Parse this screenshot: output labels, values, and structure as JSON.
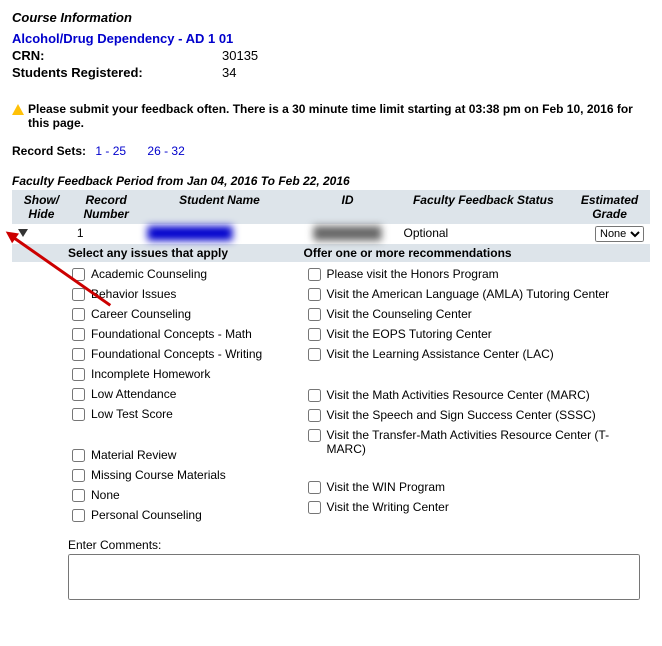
{
  "course": {
    "header": "Course Information",
    "title": "Alcohol/Drug Dependency - AD 1 01",
    "crn_label": "CRN:",
    "crn_value": "30135",
    "students_label": "Students Registered:",
    "students_value": "34"
  },
  "alert": "Please submit your feedback often. There is a 30 minute time limit starting at 03:38 pm on Feb 10, 2016 for this page.",
  "record_sets": {
    "label": "Record Sets:",
    "range1": "1 - 25",
    "range2": "26 - 32"
  },
  "period": "Faculty Feedback Period from Jan 04, 2016 To Feb 22, 2016",
  "columns": {
    "showhide": "Show/ Hide",
    "record": "Record Number",
    "name": "Student Name",
    "id": "ID",
    "status": "Faculty Feedback Status",
    "grade": "Estimated Grade"
  },
  "row": {
    "record_number": "1",
    "name_redacted": "██████████",
    "id_redacted": "████████",
    "status": "Optional",
    "grade_selected": "None"
  },
  "sections": {
    "issues_header": "Select any issues that apply",
    "recs_header": "Offer one or more recommendations"
  },
  "issues": [
    "Academic Counseling",
    "Behavior Issues",
    "Career Counseling",
    "Foundational Concepts - Math",
    "Foundational Concepts - Writing",
    "Incomplete Homework",
    "Low Attendance",
    "Low Test Score",
    "Material Review",
    "Missing Course Materials",
    "None",
    "Personal Counseling"
  ],
  "recommendations": [
    "Please visit the Honors Program",
    "Visit the American Language (AMLA) Tutoring Center",
    "Visit the Counseling Center",
    "Visit the EOPS Tutoring Center",
    "Visit the Learning Assistance Center (LAC)",
    "Visit the Math Activities Resource Center (MARC)",
    "Visit the Speech and Sign Success Center (SSSC)",
    "Visit the Transfer-Math Activities Resource Center (T-MARC)",
    "Visit the WIN Program",
    "Visit the Writing Center"
  ],
  "comments_label": "Enter Comments:"
}
